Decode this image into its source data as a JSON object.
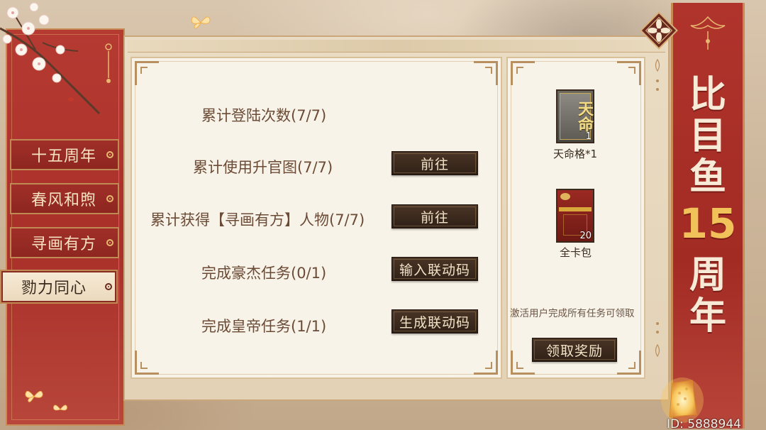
{
  "tabs": [
    {
      "label": "十五周年",
      "active": false
    },
    {
      "label": "春风和煦",
      "active": false
    },
    {
      "label": "寻画有方",
      "active": false
    },
    {
      "label": "勠力同心",
      "active": true
    }
  ],
  "tasks": [
    {
      "label": "累计登陆次数(7/7)",
      "button": ""
    },
    {
      "label": "累计使用升官图(7/7)",
      "button": "前往"
    },
    {
      "label": "累计获得【寻画有方】人物(7/7)",
      "button": "前往"
    },
    {
      "label": "完成豪杰任务(0/1)",
      "button": "输入联动码"
    },
    {
      "label": "完成皇帝任务(1/1)",
      "button": "生成联动码"
    }
  ],
  "rewards": [
    {
      "name": "天命格*1",
      "count": "1",
      "icon": "tianmingge-card-icon",
      "card_text": "天命"
    },
    {
      "name": "全卡包",
      "count": "20",
      "icon": "card-pack-icon"
    }
  ],
  "reward_note": "激活用户完成所有任务可领取",
  "claim_button": "领取奖励",
  "banner": {
    "chars": [
      "比",
      "目",
      "鱼",
      "15",
      "周",
      "年"
    ]
  },
  "uid_text": "ID: 5888944",
  "colors": {
    "accent_red": "#a93029",
    "button_dark": "#3a2a1e",
    "gold": "#f2c25a"
  }
}
